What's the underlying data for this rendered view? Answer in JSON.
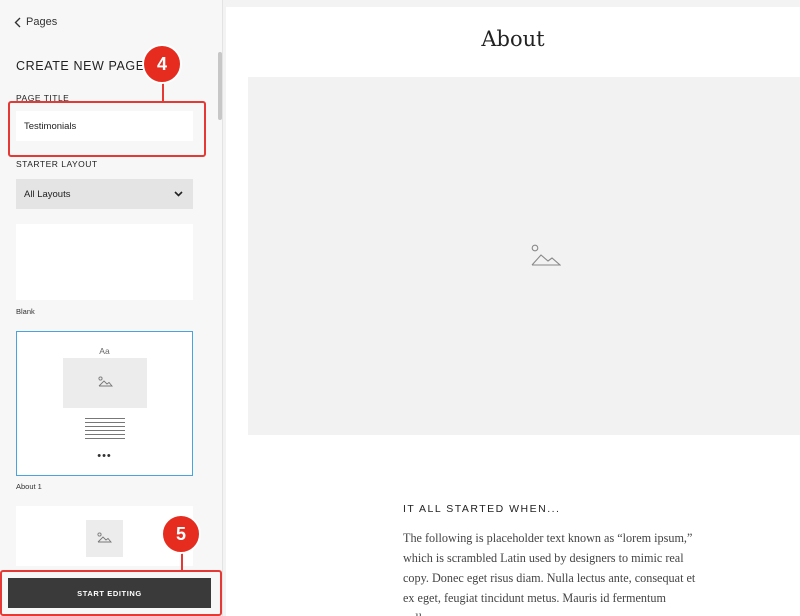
{
  "sidebar": {
    "back_label": "Pages",
    "heading": "CREATE NEW PAGE",
    "page_title_label": "PAGE TITLE",
    "page_title_value": "Testimonials",
    "starter_layout_label": "STARTER LAYOUT",
    "layout_select_value": "All Layouts",
    "layouts": [
      {
        "caption": "Blank"
      },
      {
        "caption": "About 1",
        "thumb_text": "Aa",
        "selected": true
      }
    ],
    "start_button_label": "START EDITING"
  },
  "preview": {
    "title": "About",
    "section_heading": "IT ALL STARTED WHEN...",
    "body_lines": [
      "The following is placeholder text known as “lorem ipsum,”",
      "which is scrambled Latin used by designers to mimic real",
      "copy. Donec eget risus diam. Nulla lectus ante, consequat et",
      "ex eget, feugiat tincidunt metus. Mauris id fermentum",
      "nulla."
    ]
  },
  "annotations": {
    "step_4": "4",
    "step_5": "5",
    "highlight_color": "#e53935"
  },
  "icons": {
    "back": "chevron-left-icon",
    "select": "chevron-down-icon",
    "image": "image-placeholder-icon",
    "more": "more-dots-icon"
  }
}
